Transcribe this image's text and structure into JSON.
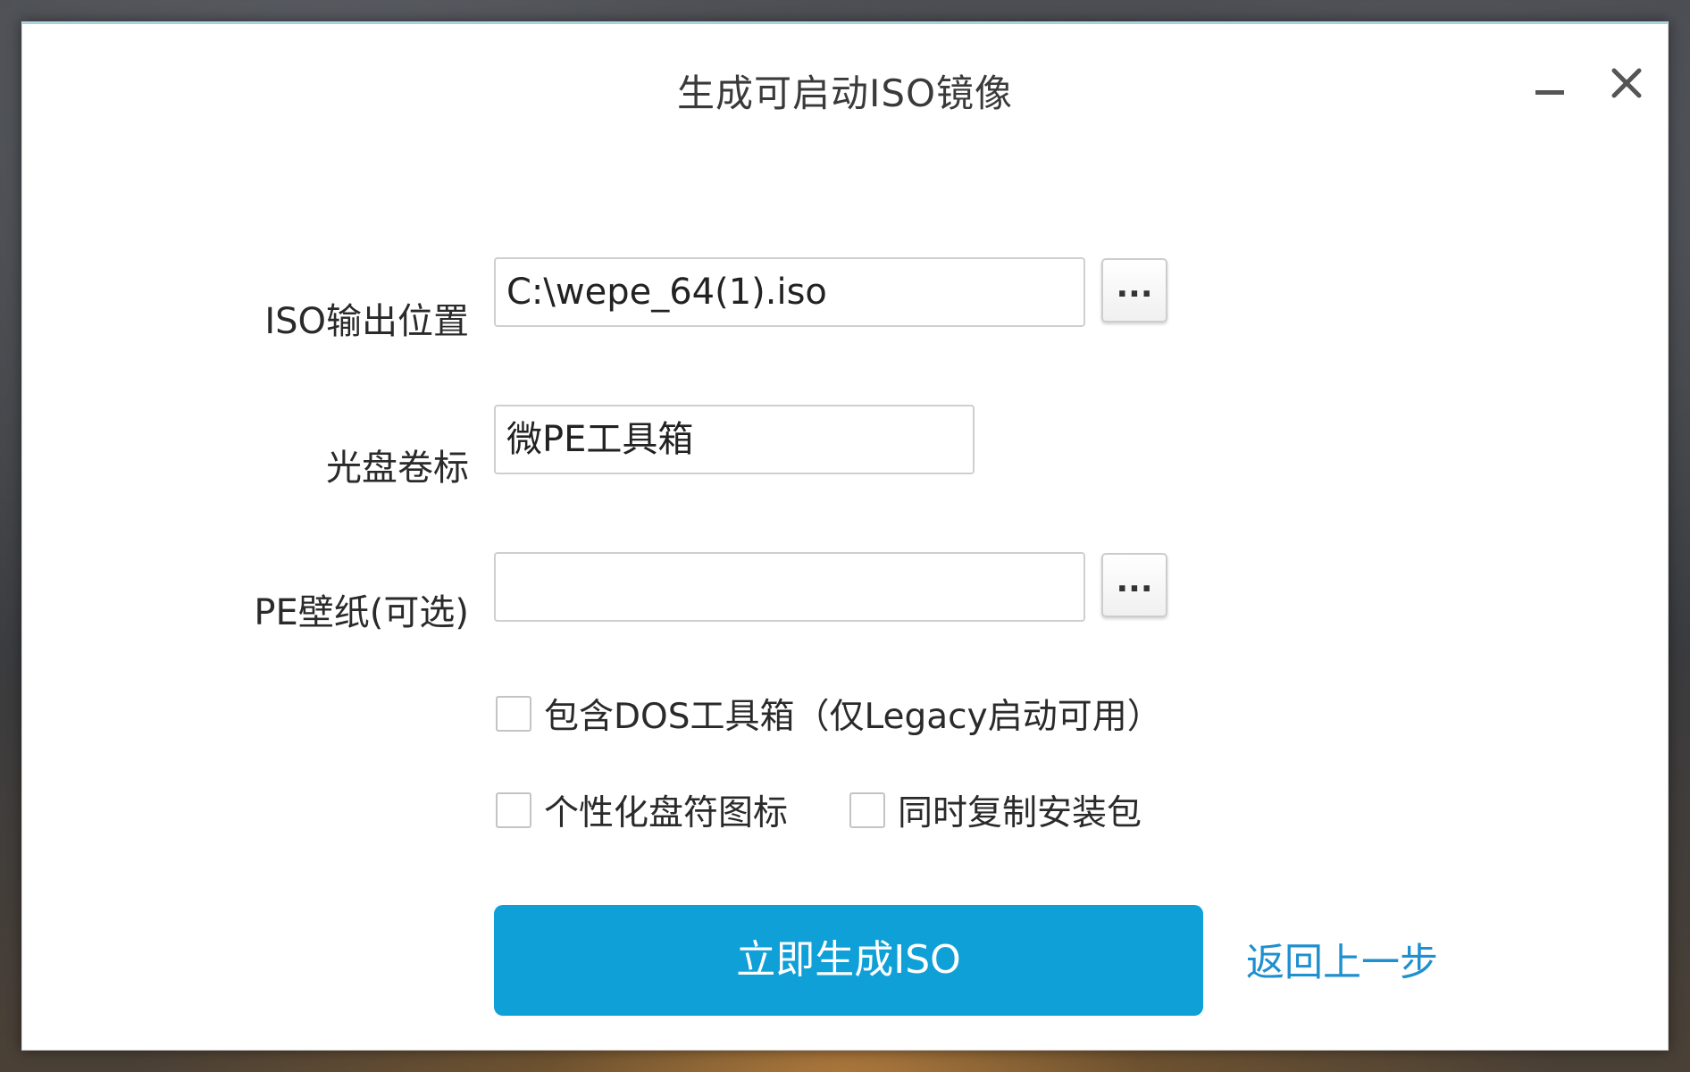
{
  "window": {
    "title": "生成可启动ISO镜像"
  },
  "form": {
    "iso_output": {
      "label": "ISO输出位置",
      "value": "C:\\wepe_64(1).iso",
      "browse_label": "..."
    },
    "volume_label": {
      "label": "光盘卷标",
      "value": "微PE工具箱"
    },
    "wallpaper": {
      "label": "PE壁纸(可选)",
      "value": "",
      "browse_label": "..."
    }
  },
  "options": {
    "include_dos": {
      "label": "包含DOS工具箱（仅Legacy启动可用）",
      "checked": false
    },
    "custom_drive_icons": {
      "label": "个性化盘符图标",
      "checked": false
    },
    "copy_installer": {
      "label": "同时复制安装包",
      "checked": false
    }
  },
  "actions": {
    "generate_label": "立即生成ISO",
    "back_label": "返回上一步"
  },
  "colors": {
    "primary": "#0fa0d8",
    "link": "#1e8fcf"
  },
  "icons": {
    "minimize": "minimize-icon",
    "close": "close-icon"
  }
}
